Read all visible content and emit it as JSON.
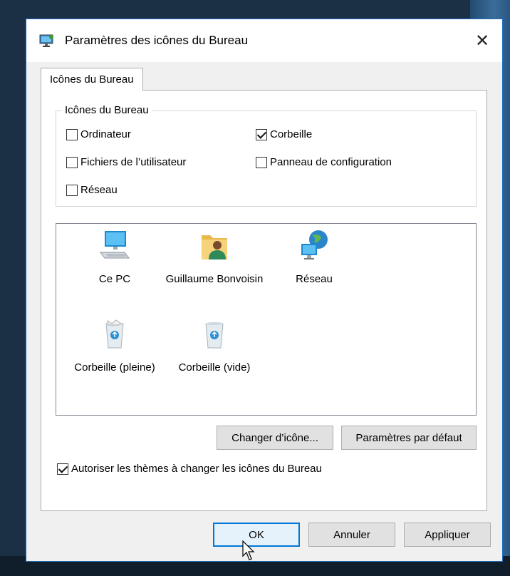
{
  "dialog": {
    "title": "Paramètres des icônes du Bureau",
    "close_glyph": "✕"
  },
  "tab": {
    "label": "Icônes du Bureau"
  },
  "group": {
    "legend": "Icônes du Bureau",
    "checkboxes": [
      {
        "label": "Ordinateur",
        "checked": false
      },
      {
        "label": "Corbeille",
        "checked": true
      },
      {
        "label": "Fichiers de l’utilisateur",
        "checked": false
      },
      {
        "label": "Panneau de configuration",
        "checked": false
      },
      {
        "label": "Réseau",
        "checked": false
      }
    ]
  },
  "icons": [
    {
      "label": "Ce PC",
      "icon": "computer-icon"
    },
    {
      "label": "Guillaume Bonvoisin",
      "icon": "user-folder-icon"
    },
    {
      "label": "Réseau",
      "icon": "network-icon"
    },
    {
      "label": "Corbeille (pleine)",
      "icon": "recycle-bin-full-icon"
    },
    {
      "label": "Corbeille (vide)",
      "icon": "recycle-bin-empty-icon"
    }
  ],
  "buttons": {
    "change_icon": "Changer d’icône...",
    "restore_default": "Paramètres par défaut",
    "ok": "OK",
    "cancel": "Annuler",
    "apply": "Appliquer"
  },
  "allow_themes": {
    "label": "Autoriser les thèmes à changer les icônes du Bureau",
    "checked": true
  },
  "colors": {
    "accent": "#0078d7",
    "dialog_bg": "#f0f0f0",
    "desktop_bg": "#1b2f45"
  }
}
